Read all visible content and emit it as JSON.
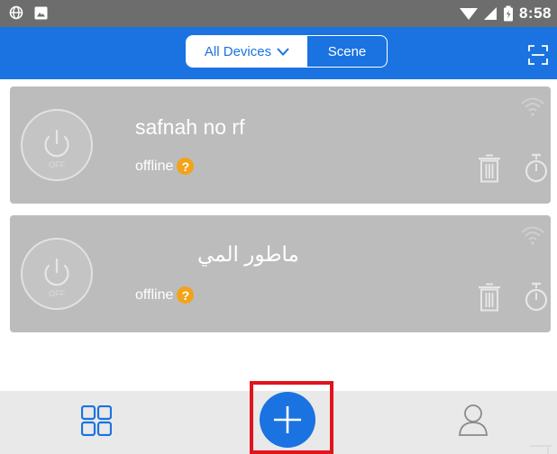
{
  "status_bar": {
    "time": "8:58",
    "icons": [
      "globe-icon",
      "image-icon",
      "wifi-signal-icon",
      "cell-signal-icon",
      "battery-icon"
    ]
  },
  "header": {
    "segments": [
      "All Devices",
      "Scene"
    ],
    "selected_segment": "All Devices",
    "scan_icon": "scan-icon"
  },
  "devices": [
    {
      "name": "safnah no rf",
      "status": "offline",
      "status_badge": "?",
      "power_label": "OFF"
    },
    {
      "name": "ماطور المي",
      "status": "offline",
      "status_badge": "?",
      "power_label": "OFF"
    }
  ],
  "bottom_nav": {
    "items": [
      "devices-grid-icon",
      "add-icon",
      "user-icon"
    ]
  },
  "colors": {
    "primary": "#1a73e0",
    "card_bg": "#bcbcbc",
    "badge": "#f3a31a",
    "highlight": "#e1141c",
    "status_bar": "#6d6d6d"
  }
}
